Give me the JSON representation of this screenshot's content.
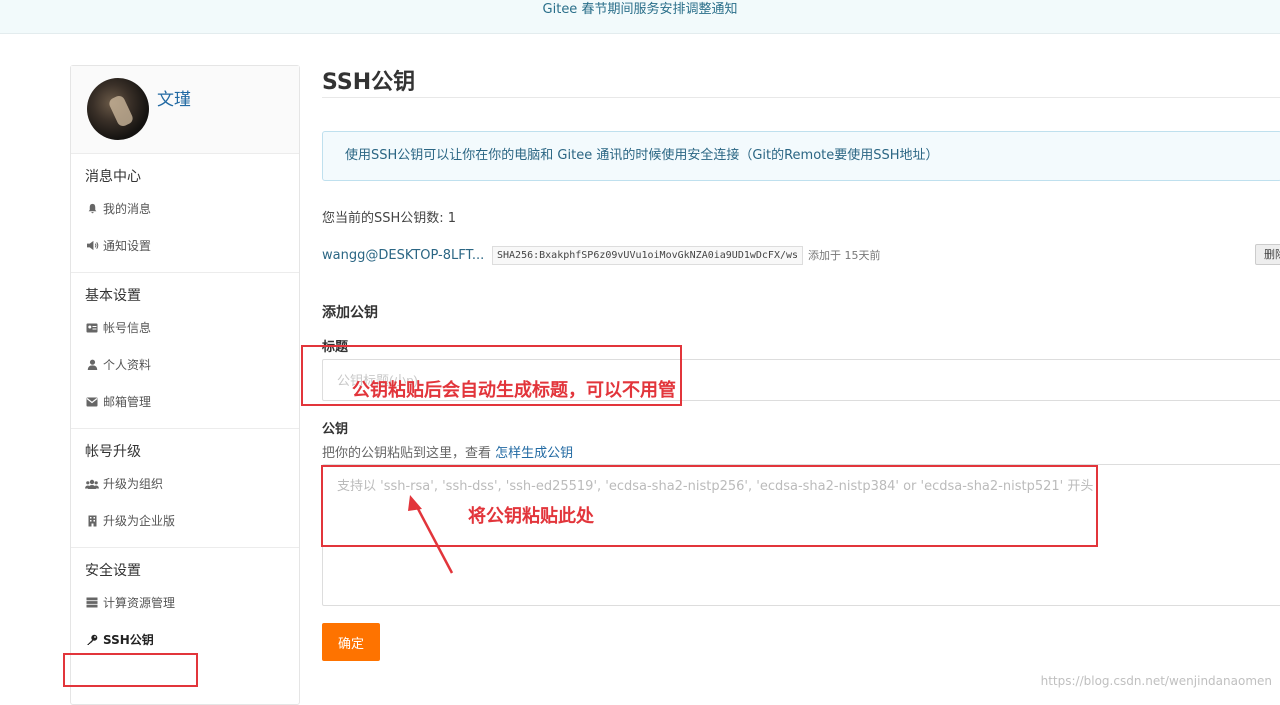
{
  "banner": {
    "text": "Gitee 春节期间服务安排调整通知"
  },
  "user": {
    "name": "文瑾"
  },
  "sidebar": {
    "groups": [
      {
        "title": "消息中心",
        "items": [
          {
            "label": "我的消息",
            "icon": "bell-icon"
          },
          {
            "label": "通知设置",
            "icon": "speaker-icon"
          }
        ]
      },
      {
        "title": "基本设置",
        "items": [
          {
            "label": "帐号信息",
            "icon": "id-card-icon"
          },
          {
            "label": "个人资料",
            "icon": "user-icon"
          },
          {
            "label": "邮箱管理",
            "icon": "envelope-icon"
          }
        ]
      },
      {
        "title": "帐号升级",
        "items": [
          {
            "label": "升级为组织",
            "icon": "users-icon"
          },
          {
            "label": "升级为企业版",
            "icon": "building-icon"
          }
        ]
      },
      {
        "title": "安全设置",
        "items": [
          {
            "label": "计算资源管理",
            "icon": "server-icon"
          },
          {
            "label": "SSH公钥",
            "icon": "key-icon",
            "active": true
          }
        ]
      }
    ]
  },
  "main": {
    "title": "SSH公钥",
    "info": "使用SSH公钥可以让你在你的电脑和 Gitee 通讯的时候使用安全连接（Git的Remote要使用SSH地址）",
    "key_count_label": "您当前的SSH公钥数: 1",
    "existing_key": {
      "title": "wangg@DESKTOP-8LFT...",
      "fingerprint": "SHA256:BxakphfSP6z09vUVu1oiMovGkNZA0ia9UD1wDcFX/ws",
      "added": "添加于 15天前",
      "delete_label": "删除"
    },
    "add_section": "添加公钥",
    "title_label": "标题",
    "title_placeholder": "公钥标题(小p)",
    "key_label": "公钥",
    "key_hint": "把你的公钥粘贴到这里，查看 ",
    "key_hint_link": "怎样生成公钥",
    "key_placeholder": "支持以 'ssh-rsa', 'ssh-dss', 'ssh-ed25519', 'ecdsa-sha2-nistp256', 'ecdsa-sha2-nistp384' or 'ecdsa-sha2-nistp521' 开头",
    "submit_label": "确定"
  },
  "annotations": {
    "title_note": "公钥粘贴后会自动生成标题，可以不用管",
    "key_note": "将公钥粘贴此处",
    "color": "#e2353b"
  },
  "watermark": "https://blog.csdn.net/wenjindanaomen"
}
